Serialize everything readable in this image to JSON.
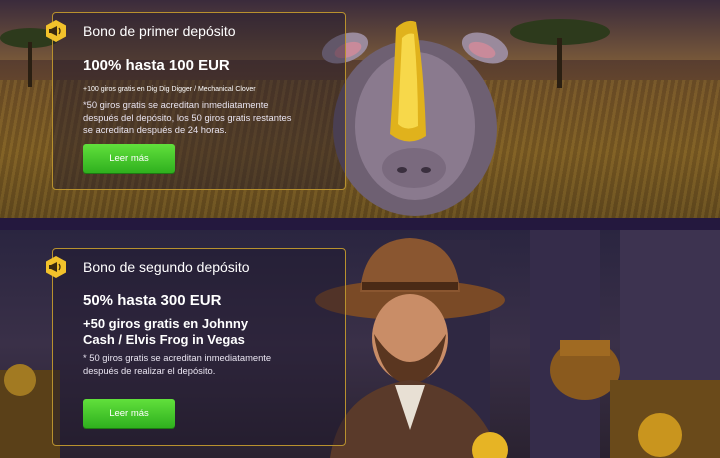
{
  "first_bonus": {
    "title": "Bono de primer depósito",
    "headline": "100% hasta 100 EUR",
    "spins": "+100 giros gratis en Dig Dig Digger / Mechanical Clover",
    "note": "*50 giros gratis se acreditan inmediatamente después del depósito, los 50 giros gratis restantes se acreditan después de 24 horas.",
    "button_label": "Leer más"
  },
  "second_bonus": {
    "title": "Bono de segundo depósito",
    "headline": "50% hasta 300 EUR",
    "spins": "+50 giros gratis en Johnny Cash / Elvis Frog in Vegas",
    "note": "* 50 giros gratis se acreditan inmediatamente después de realizar el depósito.",
    "button_label": "Leer más"
  },
  "colors": {
    "card_border": "#b8912e",
    "badge": "#f2c22b",
    "button": "#3cc025"
  }
}
